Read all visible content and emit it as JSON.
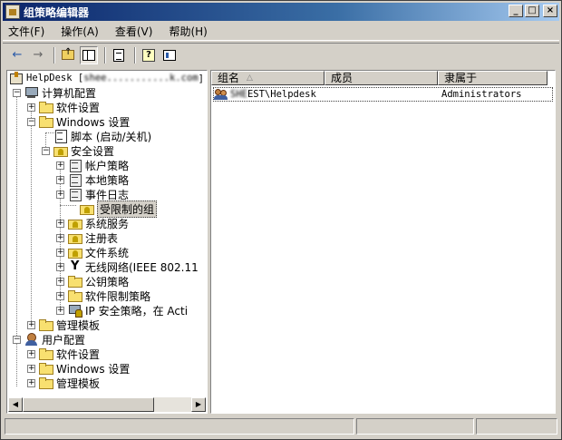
{
  "window": {
    "title": "组策略编辑器"
  },
  "title_buttons": [
    "_",
    "□",
    "×"
  ],
  "menu": [
    "文件(F)",
    "操作(A)",
    "查看(V)",
    "帮助(H)"
  ],
  "toolbar": {
    "back_icon": "←",
    "forward_icon": "→"
  },
  "tree": {
    "root": "HelpDesk [",
    "root_blurred": "shee...........k.com",
    "root_suffix": "] 策",
    "items": [
      {
        "label": "计算机配置",
        "icon": "computer-icon",
        "expander": "−"
      },
      {
        "label": "软件设置",
        "icon": "folder-icon",
        "expander": "+"
      },
      {
        "label": "Windows 设置",
        "icon": "folder-icon",
        "expander": "−"
      },
      {
        "label": "脚本 (启动/关机)",
        "icon": "script-icon",
        "expander": ""
      },
      {
        "label": "安全设置",
        "icon": "security-icon",
        "expander": "−"
      },
      {
        "label": "帐户策略",
        "icon": "policy-icon",
        "expander": "+"
      },
      {
        "label": "本地策略",
        "icon": "policy-icon",
        "expander": "+"
      },
      {
        "label": "事件日志",
        "icon": "policy-icon",
        "expander": "+"
      },
      {
        "label": "受限制的组",
        "icon": "security-folder-icon",
        "expander": ""
      },
      {
        "label": "系统服务",
        "icon": "security-folder-icon",
        "expander": "+"
      },
      {
        "label": "注册表",
        "icon": "security-folder-icon",
        "expander": "+"
      },
      {
        "label": "文件系统",
        "icon": "security-folder-icon",
        "expander": "+"
      },
      {
        "label": "无线网络(IEEE 802.11",
        "icon": "antenna-icon",
        "expander": "+"
      },
      {
        "label": "公钥策略",
        "icon": "folder-icon",
        "expander": "+"
      },
      {
        "label": "软件限制策略",
        "icon": "folder-icon",
        "expander": "+"
      },
      {
        "label": "IP 安全策略，在 Acti",
        "icon": "ipsec-icon",
        "expander": "+"
      },
      {
        "label": "管理模板",
        "icon": "folder-icon",
        "expander": "+"
      },
      {
        "label": "用户配置",
        "icon": "user-icon",
        "expander": "−"
      },
      {
        "label": "软件设置",
        "icon": "folder-icon",
        "expander": "+"
      },
      {
        "label": "Windows 设置",
        "icon": "folder-icon",
        "expander": "+"
      },
      {
        "label": "管理模板",
        "icon": "folder-icon",
        "expander": "+"
      }
    ]
  },
  "list": {
    "columns": [
      "组名",
      "成员",
      "隶属于"
    ],
    "sort_icon": "△",
    "rows": [
      {
        "group_blurred": "SHE",
        "group_visible": "EST\\Helpdesk",
        "members": "",
        "member_of": "Administrators"
      }
    ]
  }
}
